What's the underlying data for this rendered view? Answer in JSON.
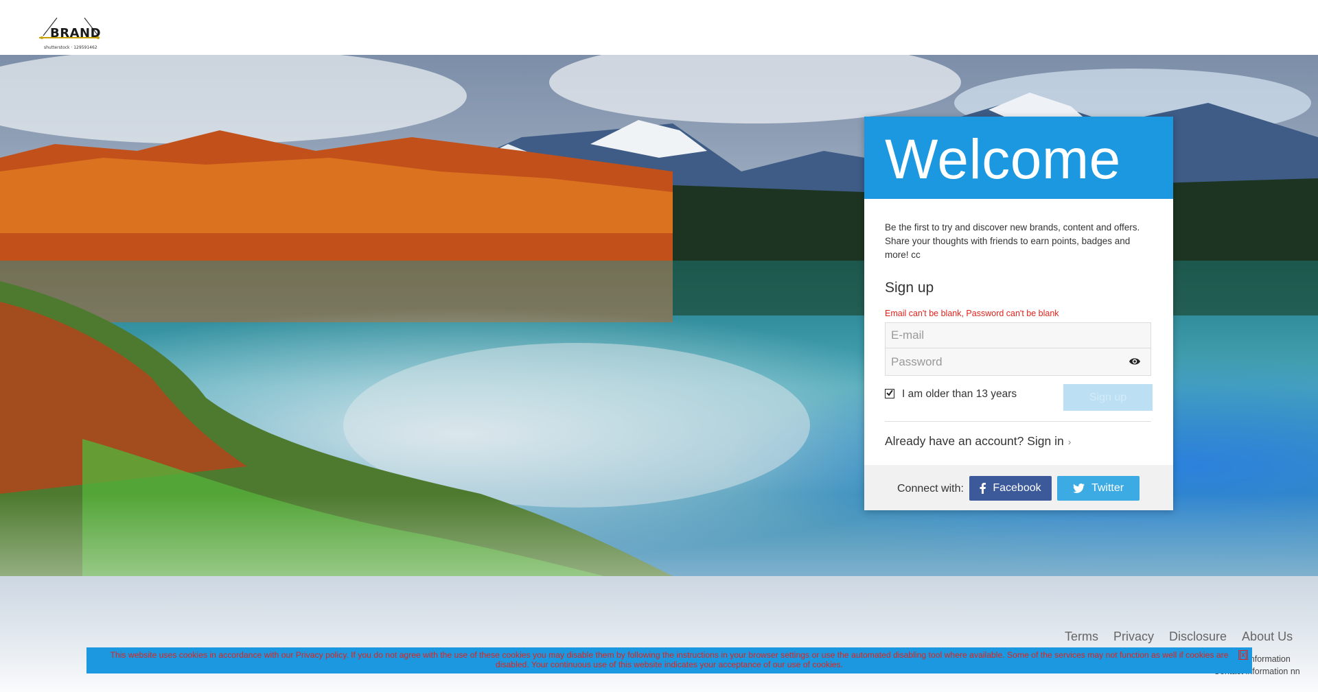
{
  "header": {
    "logo_text": "BRAND",
    "logo_caption": "shutterstock · 129591462"
  },
  "card": {
    "title": "Welcome",
    "intro": "Be the first to try and discover new brands, content and offers. Share your thoughts with friends to earn points, badges and more! cc",
    "signup_heading": "Sign up",
    "error": "Email can't be blank, Password can't be blank",
    "email_placeholder": "E-mail",
    "password_placeholder": "Password",
    "age_label": "I am older than 13 years",
    "age_checked": true,
    "signup_button": "Sign up",
    "signin_link": "Already have an account? Sign in",
    "connect_label": "Connect with:",
    "facebook_label": "Facebook",
    "twitter_label": "Twitter"
  },
  "footer": {
    "links": [
      "Terms",
      "Privacy",
      "Disclosure",
      "About Us"
    ],
    "contact_line1": "information",
    "contact_line2": "Contact information nn"
  },
  "cookie_bar": {
    "text": "This website uses cookies in accordance with our Privacy policy. If you do not agree with the use of these cookies you may disable them by following the instructions in your browser settings or use the automated disabling tool where available. Some of the services may not function as well if cookies are disabled. Your continuous use of this website indicates your acceptance of our use of cookies.",
    "close_label": "[x]"
  },
  "colors": {
    "brand_blue": "#1b98df",
    "error_red": "#e0231c",
    "facebook": "#3c5a9a",
    "twitter": "#3cabe4"
  }
}
